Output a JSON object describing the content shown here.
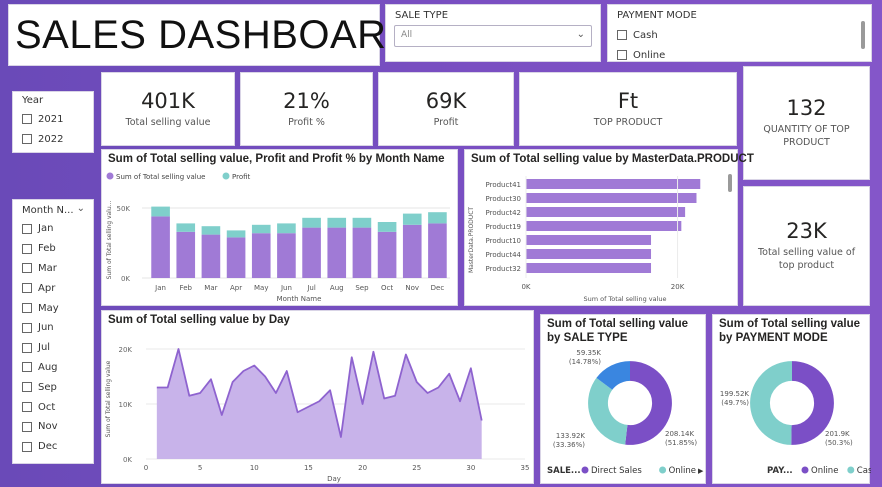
{
  "header": {
    "title": "SALES DASHBOARD"
  },
  "sale_type_slicer": {
    "label": "SALE TYPE",
    "value": "All"
  },
  "payment_mode_slicer": {
    "label": "PAYMENT MODE",
    "options": [
      "Cash",
      "Online"
    ]
  },
  "year_slicer": {
    "label": "Year",
    "options": [
      "2021",
      "2022"
    ]
  },
  "month_slicer": {
    "label": "Month N...",
    "options": [
      "Jan",
      "Feb",
      "Mar",
      "Apr",
      "May",
      "Jun",
      "Jul",
      "Aug",
      "Sep",
      "Oct",
      "Nov",
      "Dec"
    ]
  },
  "kpis": [
    {
      "value": "401K",
      "label": "Total selling value"
    },
    {
      "value": "21%",
      "label": "Profit %"
    },
    {
      "value": "69K",
      "label": "Profit"
    },
    {
      "value": "Ft",
      "label": "TOP PRODUCT"
    },
    {
      "value": "132",
      "label": "QUANTITY OF TOP PRODUCT"
    },
    {
      "value": "23K",
      "label": "Total selling value  of top product"
    }
  ],
  "colors": {
    "primary": "#a07ad6",
    "secondary": "#7fcfcb",
    "accent_dark": "#7b4fc6",
    "blue": "#3a86e0"
  },
  "chart_data": [
    {
      "type": "bar",
      "title": "Sum of Total selling value, Profit and Profit % by Month Name",
      "xlabel": "Month Name",
      "ylabel": "Sum of Total selling valu...",
      "yticks": [
        "50K",
        "0K"
      ],
      "ylim": [
        0,
        55
      ],
      "categories": [
        "Jan",
        "Feb",
        "Mar",
        "Apr",
        "May",
        "Jun",
        "Jul",
        "Aug",
        "Sep",
        "Oct",
        "Nov",
        "Dec"
      ],
      "series": [
        {
          "name": "Sum of Total selling value",
          "values": [
            44,
            33,
            31,
            29,
            32,
            32,
            36,
            36,
            36,
            33,
            38,
            39
          ]
        },
        {
          "name": "Profit",
          "values": [
            7,
            6,
            6,
            5,
            6,
            7,
            7,
            7,
            7,
            7,
            8,
            8
          ]
        }
      ],
      "legend": "top-left"
    },
    {
      "type": "bar",
      "orientation": "horizontal",
      "title": "Sum of Total selling value by MasterData.PRODUCT",
      "xlabel": "Sum of Total selling value",
      "ylabel": "MasterData.PRODUCT",
      "xticks": [
        "0K",
        "20K"
      ],
      "xlim": [
        0,
        26
      ],
      "categories": [
        "Product41",
        "Product30",
        "Product42",
        "Product19",
        "Product10",
        "Product44",
        "Product32"
      ],
      "values": [
        23,
        22.5,
        21,
        20.5,
        16.5,
        16.5,
        16.5
      ]
    },
    {
      "type": "area",
      "title": "Sum of Total selling value by Day",
      "xlabel": "Day",
      "ylabel": "Sum of Total selling value",
      "yticks": [
        "20K",
        "10K",
        "0K"
      ],
      "xticks": [
        "0",
        "5",
        "10",
        "15",
        "20",
        "25",
        "30",
        "35"
      ],
      "xlim": [
        0,
        35
      ],
      "ylim": [
        0,
        22
      ],
      "x": [
        1,
        2,
        3,
        4,
        5,
        6,
        7,
        8,
        9,
        10,
        11,
        12,
        13,
        14,
        15,
        16,
        17,
        18,
        19,
        20,
        21,
        22,
        23,
        24,
        25,
        26,
        27,
        28,
        29,
        30,
        31
      ],
      "y": [
        13,
        13,
        20,
        11.5,
        12,
        14.5,
        8,
        14,
        16,
        17,
        15,
        12,
        16,
        8.5,
        9.5,
        10.5,
        12.5,
        4,
        18.5,
        10,
        19.5,
        11,
        11.5,
        19,
        14,
        12,
        13,
        15.5,
        10.5,
        16.5,
        7
      ]
    },
    {
      "type": "pie",
      "donut": true,
      "title": "Sum of Total selling value by SALE TYPE",
      "legend_title": "SALE...",
      "labels": [
        "Direct Sales",
        "Online",
        "(Blank)"
      ],
      "legend_labels": [
        "Direct Sales",
        "Online"
      ],
      "values": [
        208.14,
        133.92,
        59.35
      ],
      "data_labels": [
        "208.14K (51.85%)",
        "133.92K (33.36%)",
        "59.35K (14.78%)"
      ]
    },
    {
      "type": "pie",
      "donut": true,
      "title": "Sum of Total selling value by PAYMENT MODE",
      "legend_title": "PAY...",
      "labels": [
        "Online",
        "Cash"
      ],
      "values": [
        201.9,
        199.52
      ],
      "data_labels": [
        "201.9K (50.3%)",
        "199.52K (49.7%)"
      ]
    }
  ]
}
